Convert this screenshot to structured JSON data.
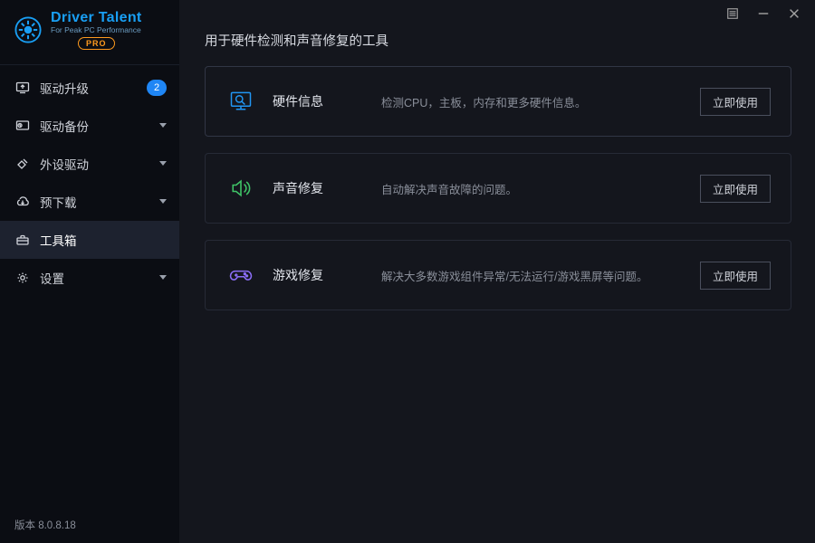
{
  "app": {
    "title": "Driver Talent",
    "subtitle": "For Peak PC Performance",
    "pro_label": "PRO",
    "version_prefix": "版本",
    "version": "8.0.8.18"
  },
  "sidebar": {
    "items": [
      {
        "icon": "upgrade",
        "label": "驱动升级",
        "badge": "2",
        "caret": false
      },
      {
        "icon": "backup",
        "label": "驱动备份",
        "badge": null,
        "caret": true
      },
      {
        "icon": "periph",
        "label": "外设驱动",
        "badge": null,
        "caret": true
      },
      {
        "icon": "predl",
        "label": "预下载",
        "badge": null,
        "caret": true
      },
      {
        "icon": "toolbox",
        "label": "工具箱",
        "badge": null,
        "caret": false,
        "active": true
      },
      {
        "icon": "settings",
        "label": "设置",
        "badge": null,
        "caret": true
      }
    ]
  },
  "main": {
    "heading": "用于硬件检测和声音修复的工具",
    "cards": [
      {
        "icon": "hardware",
        "title": "硬件信息",
        "desc": "检测CPU，主板，内存和更多硬件信息。",
        "btn": "立即使用"
      },
      {
        "icon": "sound",
        "title": "声音修复",
        "desc": "自动解决声音故障的问题。",
        "btn": "立即使用"
      },
      {
        "icon": "game",
        "title": "游戏修复",
        "desc": "解决大多数游戏组件异常/无法运行/游戏黑屏等问题。",
        "btn": "立即使用"
      }
    ]
  }
}
